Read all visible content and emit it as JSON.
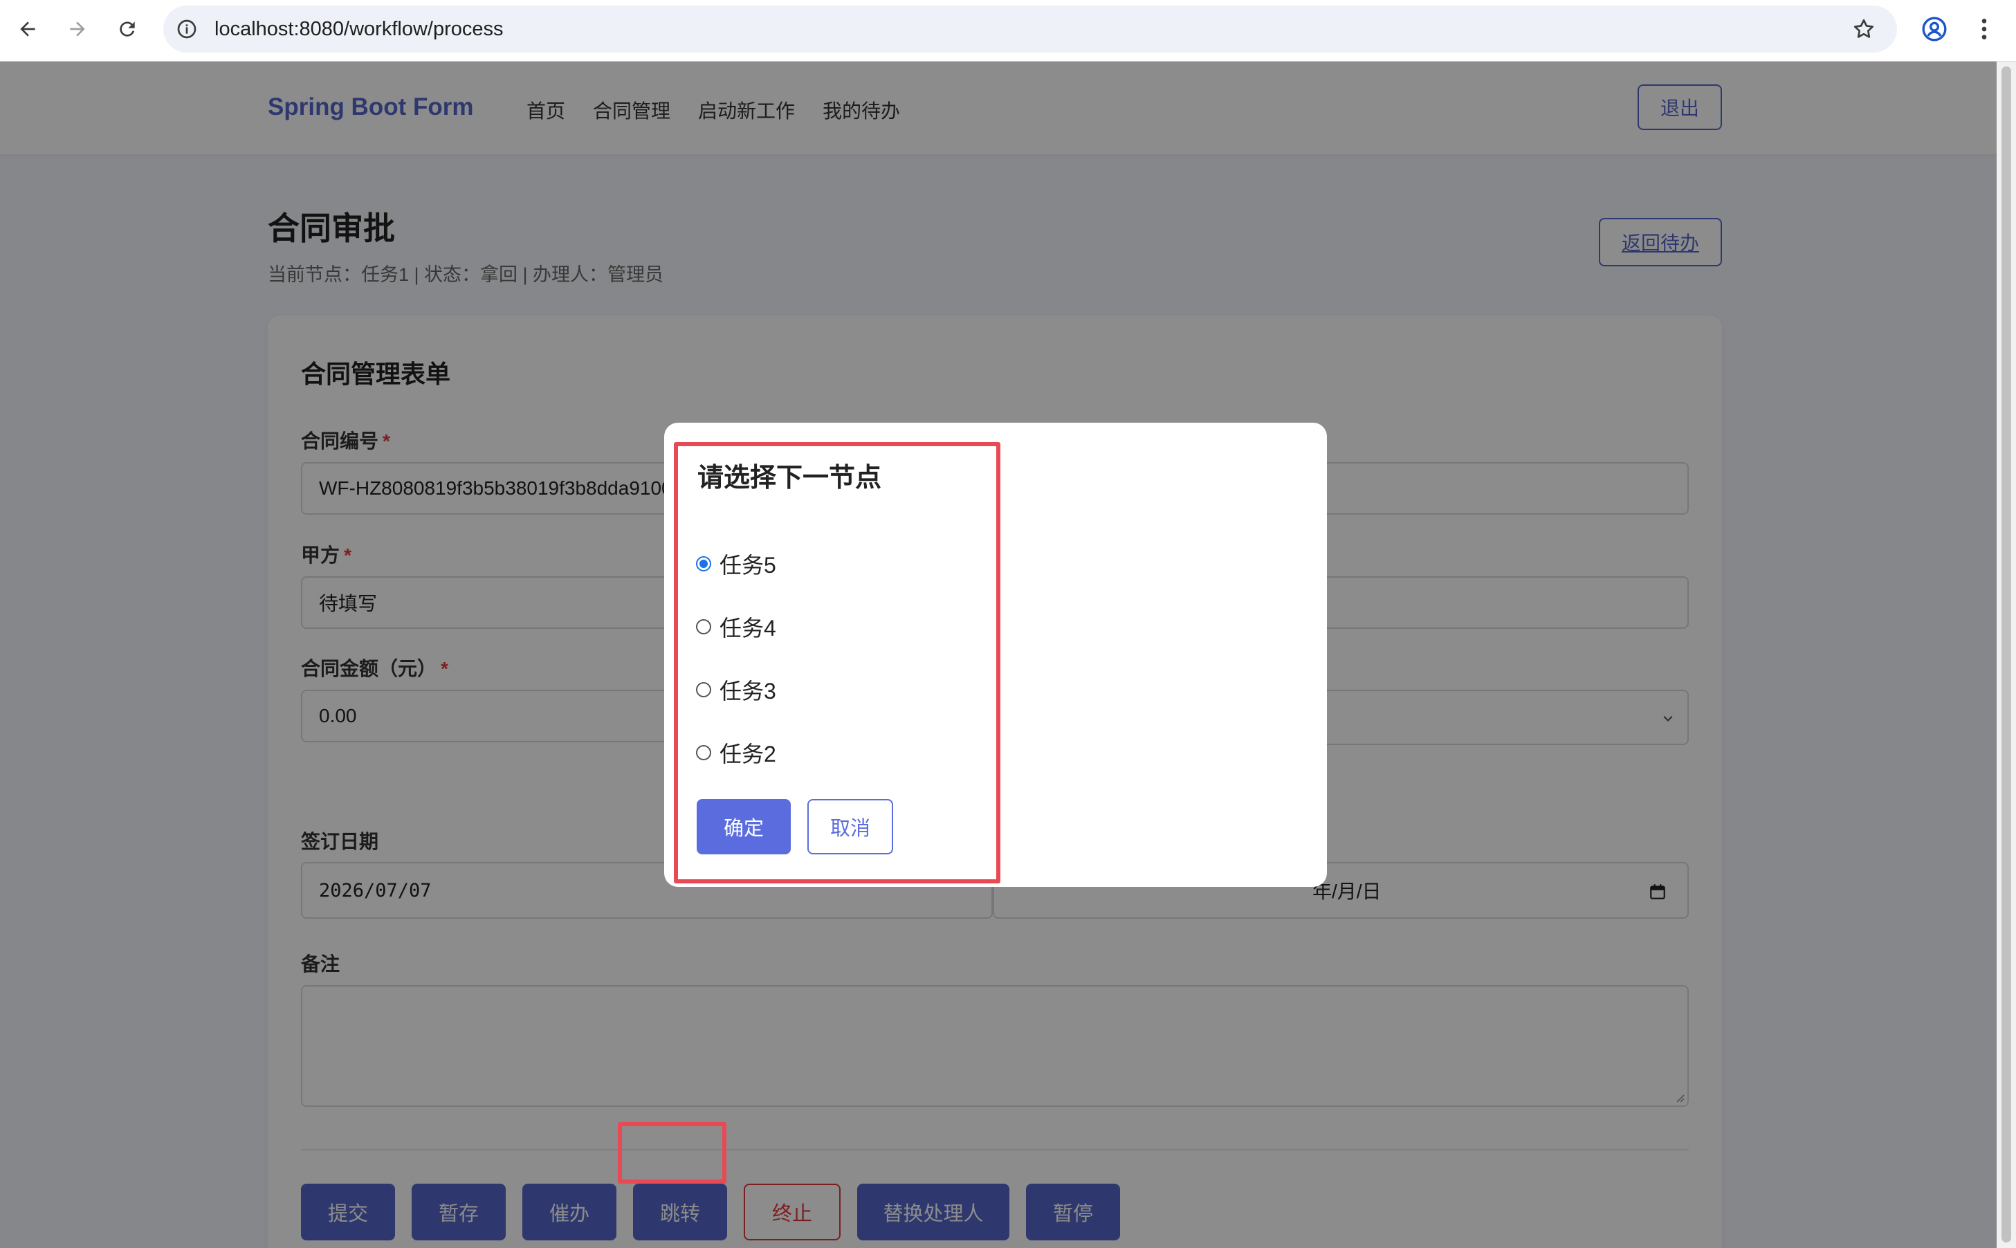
{
  "browser": {
    "url": "localhost:8080/workflow/process"
  },
  "nav": {
    "brand": "Spring Boot Form",
    "menu": [
      "首页",
      "合同管理",
      "启动新工作",
      "我的待办"
    ],
    "logout": "退出"
  },
  "header": {
    "title": "合同审批",
    "subtitle": "当前节点：任务1 | 状态：拿回 | 办理人：管理员",
    "back_button": "返回待办"
  },
  "form": {
    "title": "合同管理表单",
    "contract_no_label": "合同编号",
    "contract_no_value": "WF-HZ8080819f3b5b38019f3b8dda9100",
    "party_a_label": "甲方",
    "party_a_value": "待填写",
    "amount_label": "合同金额（元）",
    "amount_value": "0.00",
    "sign_date_label": "签订日期",
    "sign_date_value": "2026/07/07",
    "right_date_value": "年/月/日",
    "remark_label": "备注",
    "required_mark": "*"
  },
  "actions": {
    "submit": "提交",
    "save_draft": "暂存",
    "urge": "催办",
    "jump": "跳转",
    "terminate": "终止",
    "reassign": "替换处理人",
    "pause": "暂停"
  },
  "dialog": {
    "title": "请选择下一节点",
    "options": [
      "任务5",
      "任务4",
      "任务3",
      "任务2"
    ],
    "selected_index": 0,
    "confirm": "确定",
    "cancel": "取消"
  },
  "colors": {
    "accent": "#5567c9",
    "danger": "#e0393e",
    "highlight": "#e84a55",
    "radio_selected": "#1a73e8"
  }
}
